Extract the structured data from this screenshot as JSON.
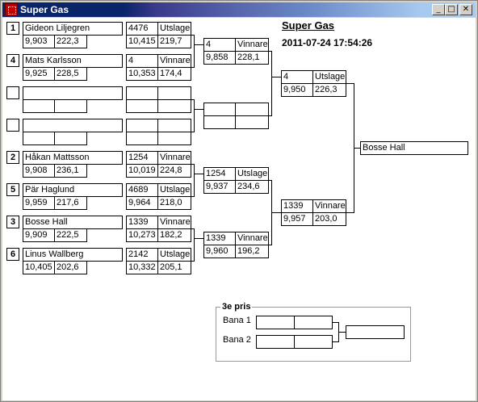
{
  "window": {
    "title": "Super Gas",
    "controls": {
      "minimize": "_",
      "maximize": "□",
      "close": "✕"
    }
  },
  "header": {
    "event_name": "Super Gas",
    "datetime": "2011-07-24 17:54:26"
  },
  "round1": [
    {
      "seed": "1",
      "name": "Gideon Liljegren",
      "time": "9,903",
      "speed": "222,3"
    },
    {
      "seed": "4",
      "name": "Mats Karlsson",
      "time": "9,925",
      "speed": "228,5"
    },
    {
      "seed": "",
      "name": "",
      "time": "",
      "speed": ""
    },
    {
      "seed": "",
      "name": "",
      "time": "",
      "speed": ""
    },
    {
      "seed": "2",
      "name": "Håkan Mattsson",
      "time": "9,908",
      "speed": "236,1"
    },
    {
      "seed": "5",
      "name": "Pär Haglund",
      "time": "9,959",
      "speed": "217,6"
    },
    {
      "seed": "3",
      "name": "Bosse Hall",
      "time": "9,909",
      "speed": "222,5"
    },
    {
      "seed": "6",
      "name": "Linus Wallberg",
      "time": "10,405",
      "speed": "202,6"
    }
  ],
  "round2": [
    {
      "no": "4476",
      "result": "Utslagen",
      "time": "10,415",
      "speed": "219,7"
    },
    {
      "no": "4",
      "result": "Vinnare",
      "time": "10,353",
      "speed": "174,4"
    },
    {
      "no": "",
      "result": "",
      "time": "",
      "speed": ""
    },
    {
      "no": "",
      "result": "",
      "time": "",
      "speed": ""
    },
    {
      "no": "1254",
      "result": "Vinnare",
      "time": "10,019",
      "speed": "224,8"
    },
    {
      "no": "4689",
      "result": "Utslagen",
      "time": "9,964",
      "speed": "218,0"
    },
    {
      "no": "1339",
      "result": "Vinnare",
      "time": "10,273",
      "speed": "182,2"
    },
    {
      "no": "2142",
      "result": "Utslagen",
      "time": "10,332",
      "speed": "205,1"
    }
  ],
  "round3": [
    {
      "no": "4",
      "result": "Vinnare",
      "time": "9,858",
      "speed": "228,1"
    },
    {
      "no": "",
      "result": "",
      "time": "",
      "speed": ""
    },
    {
      "no": "1254",
      "result": "Utslagen",
      "time": "9,937",
      "speed": "234,6"
    },
    {
      "no": "1339",
      "result": "Vinnare",
      "time": "9,960",
      "speed": "196,2"
    }
  ],
  "semifinal": [
    {
      "no": "4",
      "result": "Utslagen",
      "time": "9,950",
      "speed": "226,3"
    },
    {
      "no": "1339",
      "result": "Vinnare",
      "time": "9,957",
      "speed": "203,0"
    }
  ],
  "winner": {
    "name": "Bosse Hall"
  },
  "third_place": {
    "legend": "3e pris",
    "lane1_label": "Bana 1",
    "lane2_label": "Bana 2",
    "lane1": {
      "a": "",
      "b": ""
    },
    "lane2": {
      "a": "",
      "b": ""
    },
    "result": ""
  }
}
